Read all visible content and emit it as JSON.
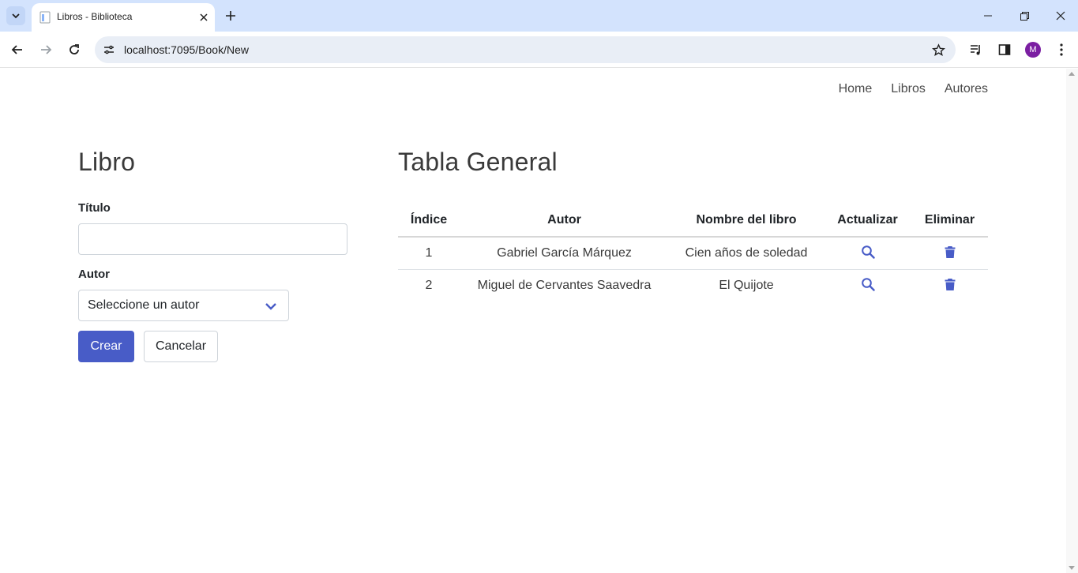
{
  "browser": {
    "tab_title": "Libros - Biblioteca",
    "url": "localhost:7095/Book/New",
    "profile_initial": "M",
    "accent": "#d3e3fd"
  },
  "nav": {
    "items": [
      "Home",
      "Libros",
      "Autores"
    ]
  },
  "form": {
    "heading": "Libro",
    "title_label": "Título",
    "title_value": "",
    "author_label": "Autor",
    "author_selected": "Seleccione un autor",
    "create_label": "Crear",
    "cancel_label": "Cancelar",
    "primary_color": "#485cc7"
  },
  "table": {
    "heading": "Tabla General",
    "columns": [
      "Índice",
      "Autor",
      "Nombre del libro",
      "Actualizar",
      "Eliminar"
    ],
    "rows": [
      {
        "index": "1",
        "author": "Gabriel García Márquez",
        "book": "Cien años de soledad",
        "update_icon": "search-icon",
        "delete_icon": "trash-icon"
      },
      {
        "index": "2",
        "author": "Miguel de Cervantes Saavedra",
        "book": "El Quijote",
        "update_icon": "search-icon",
        "delete_icon": "trash-icon"
      }
    ],
    "icon_color": "#485cc7"
  }
}
